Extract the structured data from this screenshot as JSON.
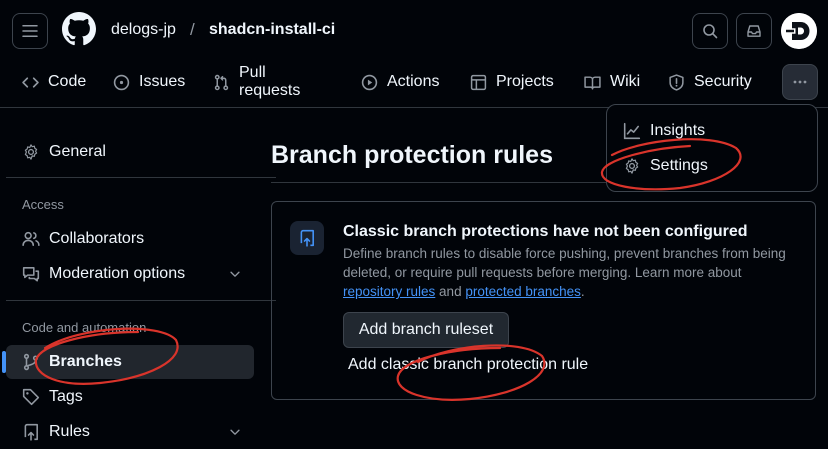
{
  "header": {
    "owner": "delogs-jp",
    "separator": "/",
    "repo": "shadcn-install-ci"
  },
  "tabs": [
    {
      "label": "Code",
      "icon": "code-icon"
    },
    {
      "label": "Issues",
      "icon": "issue-opened-icon"
    },
    {
      "label": "Pull requests",
      "icon": "git-pull-request-icon"
    },
    {
      "label": "Actions",
      "icon": "play-icon"
    },
    {
      "label": "Projects",
      "icon": "table-icon"
    },
    {
      "label": "Wiki",
      "icon": "book-icon"
    },
    {
      "label": "Security",
      "icon": "shield-icon"
    }
  ],
  "menu": {
    "items": [
      {
        "label": "Insights",
        "icon": "graph-icon"
      },
      {
        "label": "Settings",
        "icon": "gear-icon"
      }
    ]
  },
  "sidebar": {
    "general": "General",
    "access_heading": "Access",
    "collaborators": "Collaborators",
    "moderation": "Moderation options",
    "automation_heading": "Code and automation",
    "branches": "Branches",
    "tags": "Tags",
    "rules": "Rules"
  },
  "main": {
    "title": "Branch protection rules",
    "notice_title": "Classic branch protections have not been configured",
    "notice_desc_1": "Define branch rules to disable force pushing, prevent branches from being deleted, or require pull requests before merging. Learn more about ",
    "link_repo_rules": "repository rules",
    "notice_desc_and": " and ",
    "link_protected": "protected branches",
    "notice_desc_end": ".",
    "add_ruleset": "Add branch ruleset",
    "add_classic": "Add classic branch protection rule"
  },
  "colors": {
    "background": "#010409",
    "border": "#3d444d",
    "accent": "#4493f8",
    "annotation": "#d9342b"
  }
}
